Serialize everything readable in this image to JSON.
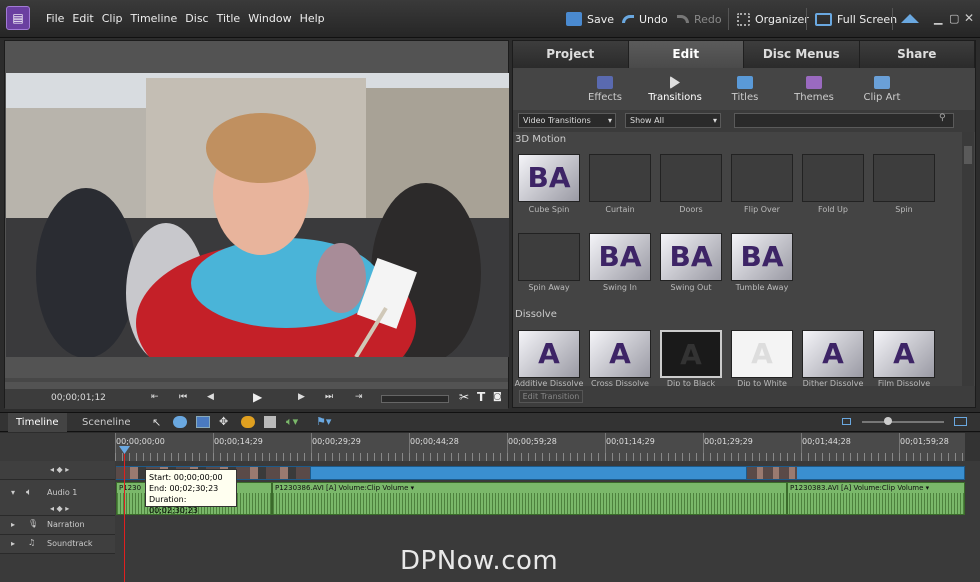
{
  "menu": [
    "File",
    "Edit",
    "Clip",
    "Timeline",
    "Disc",
    "Title",
    "Window",
    "Help"
  ],
  "toolbar": {
    "save": "Save",
    "undo": "Undo",
    "redo": "Redo",
    "organizer": "Organizer",
    "full_screen": "Full Screen"
  },
  "monitor": {
    "timecode": "00;00;01;12"
  },
  "tabs": [
    "Project",
    "Edit",
    "Disc Menus",
    "Share"
  ],
  "subtabs": [
    "Effects",
    "Transitions",
    "Titles",
    "Themes",
    "Clip Art"
  ],
  "filters": {
    "category": "Video Transitions",
    "show": "Show All"
  },
  "sections": {
    "motion": "3D Motion",
    "dissolve": "Dissolve"
  },
  "transitions_row1": [
    "Cube Spin",
    "Curtain",
    "Doors",
    "Flip Over",
    "Fold Up",
    "Spin"
  ],
  "transitions_row2": [
    "Spin Away",
    "Swing In",
    "Swing Out",
    "Tumble Away"
  ],
  "transitions_row3": [
    "Additive Dissolve",
    "Cross Dissolve",
    "Dip to Black",
    "Dip to White",
    "Dither Dissolve",
    "Film Dissolve"
  ],
  "edit_transition": "Edit Transition",
  "timeline": {
    "tab_timeline": "Timeline",
    "tab_sceneline": "Sceneline",
    "ruler": [
      "00;00;00;00",
      "00;00;14;29",
      "00;00;29;29",
      "00;00;44;28",
      "00;00;59;28",
      "00;01;14;29",
      "00;01;29;29",
      "00;01;44;28",
      "00;01;59;28"
    ],
    "tracks": {
      "audio1": "Audio 1",
      "narration": "Narration",
      "soundtrack": "Soundtrack"
    },
    "clip_a": "P1230386.AVI [A]  Volume:Clip Volume ▾",
    "clip_b": "P1230383.AVI [A]  Volume:Clip Volume ▾",
    "clip_c": "P1230",
    "tooltip": {
      "start": "Start: 00;00;00;00",
      "end": "End: 00;02;30;23",
      "duration": "Duration: 00;02;30;23"
    }
  },
  "watermark": "DPNow.com",
  "colors": {
    "accent": "#6a3fa0",
    "clip_video": "#3a8fd0",
    "clip_audio": "#7ab86a",
    "playhead": "#e02020"
  }
}
